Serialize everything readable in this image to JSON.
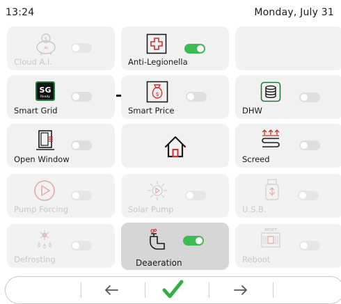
{
  "status_bar": {
    "time": "13:24",
    "date": "Monday, July 31"
  },
  "tiles": [
    {
      "label": "Cloud A.I.",
      "icon": "piggy-bank-ai-icon",
      "state": "disabled",
      "toggle": "off"
    },
    {
      "label": "Anti-Legionella",
      "icon": "medical-cross-icon",
      "state": "active",
      "toggle": "on"
    },
    {
      "label": "",
      "icon": "",
      "state": "empty",
      "toggle": "none"
    },
    {
      "label": "Smart Grid",
      "icon": "sg-ready-icon",
      "state": "active",
      "toggle": "off",
      "icon_text": "SG",
      "icon_subtext": "Ready"
    },
    {
      "label": "Smart Price",
      "icon": "money-bag-icon",
      "state": "active",
      "toggle": "off"
    },
    {
      "label": "DHW",
      "icon": "water-tank-icon",
      "state": "active",
      "toggle": "off"
    },
    {
      "label": "Open Window",
      "icon": "open-window-icon",
      "state": "active",
      "toggle": "off"
    },
    {
      "label": "",
      "icon": "home-icon",
      "state": "active",
      "toggle": "none"
    },
    {
      "label": "Screed",
      "icon": "screed-heating-icon",
      "state": "active",
      "toggle": "off"
    },
    {
      "label": "Pump Forcing",
      "icon": "pump-play-icon",
      "state": "disabled",
      "toggle": "off"
    },
    {
      "label": "Solar Pump",
      "icon": "solar-pump-icon",
      "state": "disabled",
      "toggle": "off"
    },
    {
      "label": "U.S.B.",
      "icon": "usb-icon",
      "state": "disabled",
      "toggle": "off"
    },
    {
      "label": "Defrosting",
      "icon": "defrost-icon",
      "state": "disabled",
      "toggle": "off"
    },
    {
      "label": "Deaeration",
      "icon": "deaeration-valve-icon",
      "state": "pressed",
      "toggle": "on"
    },
    {
      "label": "Reboot",
      "icon": "reset-reboot-icon",
      "state": "disabled",
      "toggle": "off",
      "icon_text": "RESET"
    }
  ],
  "nav": {
    "back_icon": "arrow-left-icon",
    "confirm_icon": "checkmark-icon",
    "forward_icon": "arrow-right-icon"
  },
  "colors": {
    "toggle_on": "#3dbb53",
    "toggle_off": "#dedede",
    "accent_red": "#d52b2b",
    "tile_bg": "#f2f2f2",
    "tile_pressed_bg": "#d6d6d6",
    "disabled_text": "#c7c7c7"
  }
}
